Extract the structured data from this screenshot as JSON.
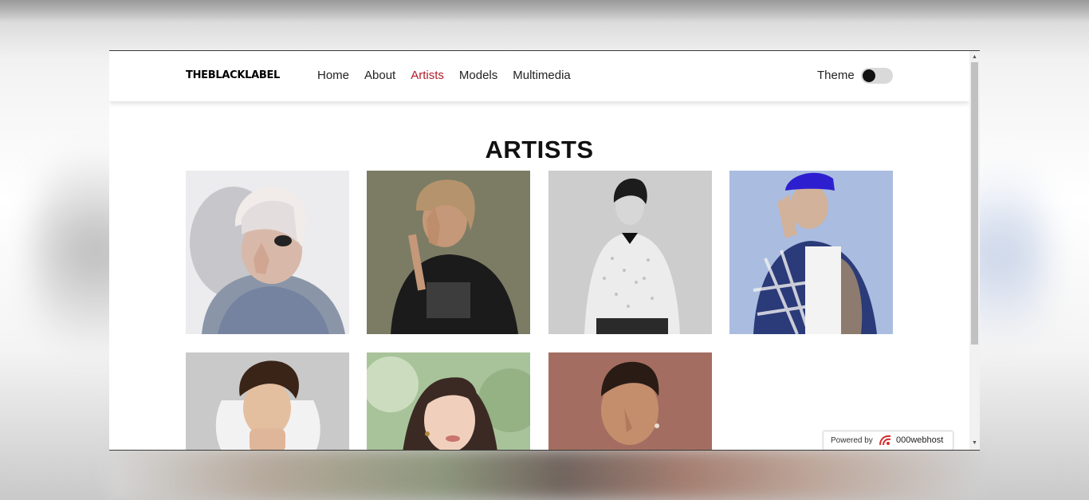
{
  "navbar": {
    "logo": "THEBLACKLABEL",
    "links": [
      {
        "label": "Home",
        "active": false
      },
      {
        "label": "About",
        "active": false
      },
      {
        "label": "Artists",
        "active": true
      },
      {
        "label": "Models",
        "active": false
      },
      {
        "label": "Multimedia",
        "active": false
      }
    ],
    "theme_label": "Theme",
    "theme_toggle_on": false
  },
  "main": {
    "heading": "ARTISTS",
    "artists": [
      {
        "photo": "artist-photo-1"
      },
      {
        "photo": "artist-photo-2"
      },
      {
        "photo": "artist-photo-3"
      },
      {
        "photo": "artist-photo-4"
      },
      {
        "photo": "artist-photo-5"
      },
      {
        "photo": "artist-photo-6"
      },
      {
        "photo": "artist-photo-7"
      }
    ]
  },
  "badge": {
    "powered_by": "Powered by",
    "brand": "000webhost"
  },
  "colors": {
    "active_link": "#b31b2a",
    "toggle_track": "#d9d9d9",
    "toggle_knob": "#111111"
  }
}
